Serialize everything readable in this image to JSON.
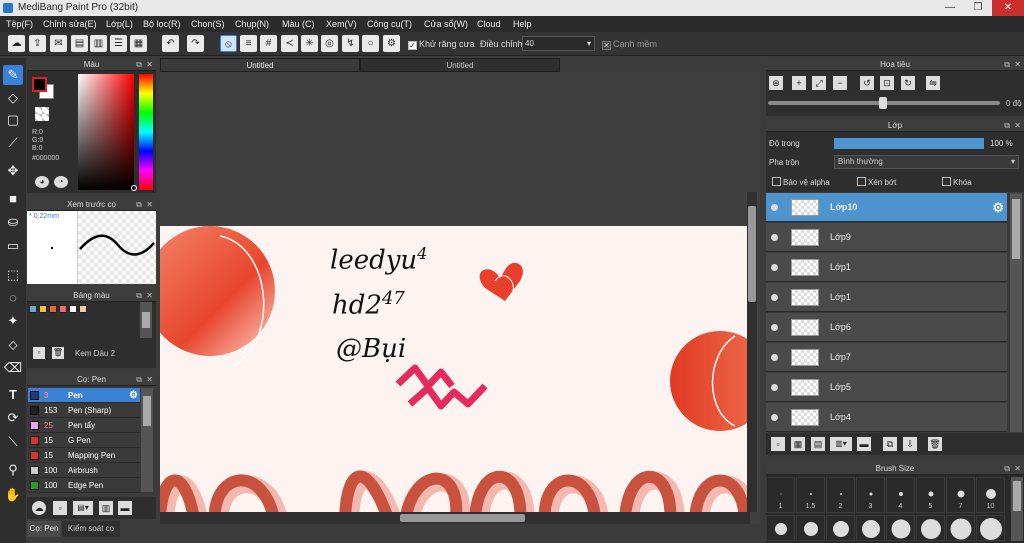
{
  "window": {
    "title": "MediBang Paint Pro (32bit)"
  },
  "menu": [
    "Tệp(F)",
    "Chỉnh sửa(E)",
    "Lớp(L)",
    "Bộ lọc(R)",
    "Chọn(S)",
    "Chụp(N)",
    "Màu (C)",
    "Xem(V)",
    "Công cụ(T)",
    "Cửa sổ(W)",
    "Cloud",
    "Help"
  ],
  "toolbar": {
    "antialias_label": "Khử răng cưa",
    "adjust_label": "Điều chỉnh",
    "adjust_value": "40",
    "smooth_label": "Cạnh mềm",
    "antialias_checked": true
  },
  "tabs": [
    "Untitled",
    "Untitled"
  ],
  "color_panel": {
    "title": "Màu",
    "r": "R:0",
    "g": "G:0",
    "b": "B:0",
    "hex": "#000000"
  },
  "brush_preview": {
    "title": "Xem trước cọ",
    "size": "0.22mm"
  },
  "palette": {
    "title": "Bảng màu",
    "name": "Kem Dâu 2",
    "colors": [
      "#6fa8c8",
      "#f2c14e",
      "#e8623a",
      "#f06a6a",
      "#ffffff",
      "#f5c8a0"
    ]
  },
  "brush_panel": {
    "title": "Cọ: Pen",
    "items": [
      {
        "size": "3",
        "name": "Pen",
        "color": "#1e3d7a",
        "selected": true
      },
      {
        "size": "153",
        "name": "Pen (Sharp)",
        "color": "#222222"
      },
      {
        "size": "25",
        "name": "Pen tẩy",
        "color": "#e6a8e6"
      },
      {
        "size": "15",
        "name": "G Pen",
        "color": "#e03030"
      },
      {
        "size": "15",
        "name": "Mapping Pen",
        "color": "#e03030"
      },
      {
        "size": "100",
        "name": "Airbrush",
        "color": "#cccccc"
      },
      {
        "size": "100",
        "name": "Edge Pen",
        "color": "#28a028"
      }
    ]
  },
  "bottom_tabs": [
    "Cọ: Pen",
    "Kiểm soát cọ"
  ],
  "navigator": {
    "title": "Hoa tiêu",
    "angle": "0 độ"
  },
  "layer_panel": {
    "title": "Lớp",
    "opacity_label": "Độ trong",
    "opacity_value": "100 %",
    "opacity": 1.0,
    "blend_label": "Pha trộn",
    "blend_value": "Bình thường",
    "alpha_label": "Bảo vệ alpha",
    "clip_label": "Xén bớt",
    "lock_label": "Khóa",
    "layers": [
      "Lớp10",
      "Lớp9",
      "Lớp1",
      "Lớp1",
      "Lớp6",
      "Lớp7",
      "Lớp5",
      "Lớp4"
    ]
  },
  "brush_size": {
    "title": "Brush Size",
    "labels": [
      "1",
      "1.5",
      "2",
      "3",
      "4",
      "5",
      "7",
      "10"
    ]
  },
  "canvas_text": {
    "line1": "leedyu",
    "sup1": "4",
    "line2": "hd2",
    "sup2": "47",
    "line3": "@Bụi"
  },
  "colors": {
    "accent": "#3b82d6",
    "layer_sel": "#4e95d0",
    "doc_bg": "#fdf3f0"
  }
}
